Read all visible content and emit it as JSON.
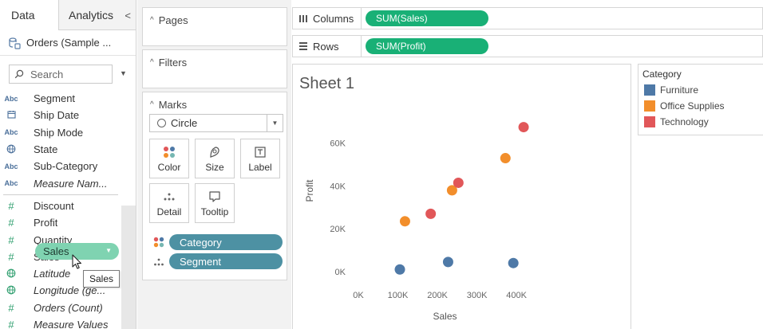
{
  "tabs": {
    "data": "Data",
    "analytics": "Analytics",
    "collapse": "<"
  },
  "datasource": {
    "name": "Orders (Sample ..."
  },
  "search": {
    "placeholder": "Search"
  },
  "dimensions": [
    {
      "type": "Abc",
      "name": "Segment",
      "italic": false
    },
    {
      "type": "date",
      "name": "Ship Date",
      "italic": false
    },
    {
      "type": "Abc",
      "name": "Ship Mode",
      "italic": false
    },
    {
      "type": "geo",
      "name": "State",
      "italic": false
    },
    {
      "type": "Abc",
      "name": "Sub-Category",
      "italic": false
    },
    {
      "type": "Abc",
      "name": "Measure Nam...",
      "italic": true
    }
  ],
  "measures": [
    {
      "type": "#",
      "name": "Discount",
      "italic": false
    },
    {
      "type": "#",
      "name": "Profit",
      "italic": false
    },
    {
      "type": "#",
      "name": "Quantity",
      "italic": false
    },
    {
      "type": "#",
      "name": "Sales",
      "italic": false
    },
    {
      "type": "geo",
      "name": "Latitude",
      "italic": true
    },
    {
      "type": "geo",
      "name": "Longitude (ge...",
      "italic": true
    },
    {
      "type": "#",
      "name": "Orders (Count)",
      "italic": true
    },
    {
      "type": "#",
      "name": "Measure Values",
      "italic": true
    }
  ],
  "drag_pill": {
    "label": "Sales"
  },
  "tooltip": {
    "text": "Sales"
  },
  "cards": {
    "pages": "Pages",
    "filters": "Filters",
    "marks": "Marks",
    "mark_type": "Circle",
    "buttons": {
      "color": "Color",
      "size": "Size",
      "label": "Label",
      "detail": "Detail",
      "tooltip": "Tooltip"
    },
    "mark_pills": [
      "Category",
      "Segment"
    ]
  },
  "shelves": {
    "columns_label": "Columns",
    "columns_pill": "SUM(Sales)",
    "rows_label": "Rows",
    "rows_pill": "SUM(Profit)"
  },
  "sheet": {
    "title": "Sheet 1"
  },
  "legend": {
    "title": "Category",
    "items": [
      {
        "name": "Furniture",
        "color": "#4e79a7"
      },
      {
        "name": "Office Supplies",
        "color": "#f28e2b"
      },
      {
        "name": "Technology",
        "color": "#e15759"
      }
    ]
  },
  "chart_data": {
    "type": "scatter",
    "title": "Sheet 1",
    "xlabel": "Sales",
    "ylabel": "Profit",
    "x_ticks": [
      "0K",
      "100K",
      "200K",
      "300K",
      "400K"
    ],
    "y_ticks": [
      "0K",
      "20K",
      "40K",
      "60K"
    ],
    "xlim": [
      0,
      430000
    ],
    "ylim": [
      -3000,
      80000
    ],
    "grid": false,
    "legend": "right",
    "series": [
      {
        "name": "Furniture",
        "color": "#4e79a7",
        "points": [
          [
            105000,
            1000
          ],
          [
            227000,
            4500
          ],
          [
            392000,
            4000
          ]
        ]
      },
      {
        "name": "Office Supplies",
        "color": "#f28e2b",
        "points": [
          [
            118000,
            23500
          ],
          [
            237000,
            38000
          ],
          [
            372000,
            53000
          ]
        ]
      },
      {
        "name": "Technology",
        "color": "#e15759",
        "points": [
          [
            183000,
            27000
          ],
          [
            253000,
            41500
          ],
          [
            418000,
            67500
          ]
        ]
      }
    ]
  }
}
